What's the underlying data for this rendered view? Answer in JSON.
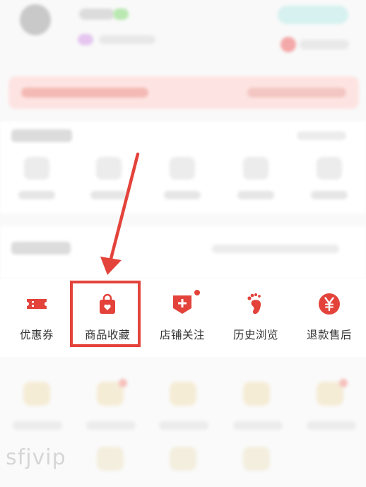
{
  "services": [
    {
      "id": "coupon",
      "label": "优惠券",
      "icon": "coupon-icon",
      "color": "#e3433b"
    },
    {
      "id": "favorites",
      "label": "商品收藏",
      "icon": "shopping-bag-heart-icon",
      "color": "#e3433b"
    },
    {
      "id": "shop-follow",
      "label": "店铺关注",
      "icon": "store-plus-icon",
      "color": "#e3433b"
    },
    {
      "id": "history",
      "label": "历史浏览",
      "icon": "footprints-icon",
      "color": "#e3433b"
    },
    {
      "id": "refund",
      "label": "退款售后",
      "icon": "yen-circle-icon",
      "color": "#e3433b"
    }
  ],
  "annotation": {
    "highlighted_item": "favorites",
    "color": "#e3433b"
  },
  "watermark": "sfjvip"
}
